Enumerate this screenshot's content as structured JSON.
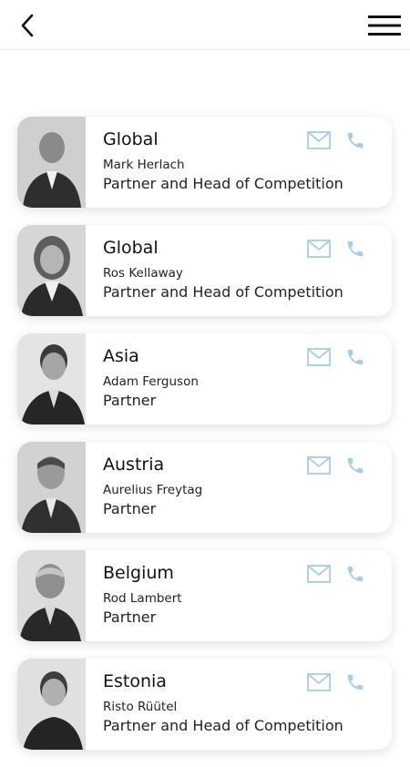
{
  "header": {
    "back_icon": "chevron-left-icon",
    "menu_icon": "hamburger-menu-icon"
  },
  "colors": {
    "accent_icon": "#a8cde2",
    "card_background": "#ffffff"
  },
  "contacts": [
    {
      "region": "Global",
      "name": "Mark Herlach",
      "role": "Partner and Head of Competition"
    },
    {
      "region": "Global",
      "name": "Ros Kellaway",
      "role": "Partner and Head of Competition"
    },
    {
      "region": "Asia",
      "name": "Adam Ferguson",
      "role": "Partner"
    },
    {
      "region": "Austria",
      "name": "Aurelius Freytag",
      "role": "Partner"
    },
    {
      "region": "Belgium",
      "name": "Rod Lambert",
      "role": "Partner"
    },
    {
      "region": "Estonia",
      "name": "Risto Rüütel",
      "role": "Partner and Head of Competition"
    }
  ]
}
